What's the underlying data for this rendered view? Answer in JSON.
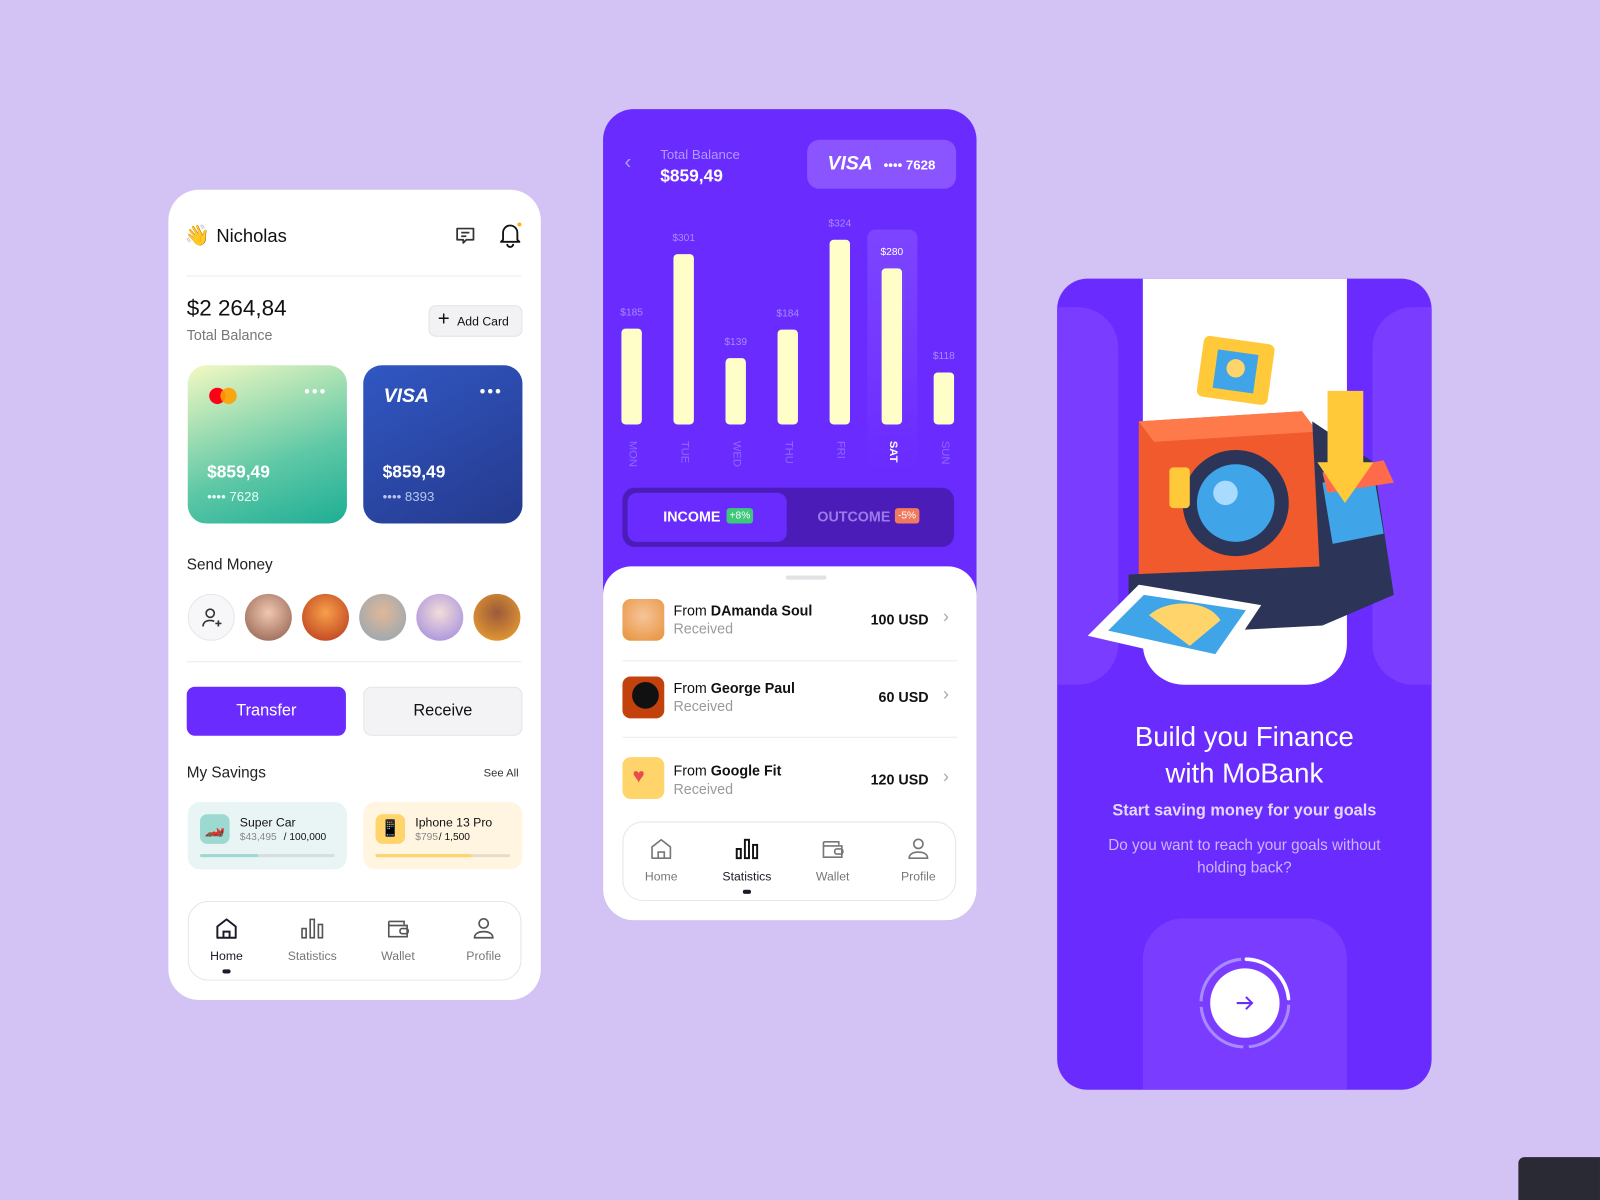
{
  "home": {
    "greeting_emoji": "👋",
    "user_name": "Nicholas",
    "icons": [
      "chat-icon",
      "bell-icon"
    ],
    "total_balance": "$2 264,84",
    "total_balance_label": "Total Balance",
    "add_card_label": "Add Card",
    "cards": [
      {
        "brand": "mastercard",
        "amount": "$859,49",
        "number": "•••• 7628",
        "colors": [
          "#f3f9c2",
          "#1dae95"
        ]
      },
      {
        "brand": "VISA",
        "amount": "$859,49",
        "number": "•••• 8393",
        "colors": [
          "#3157c3",
          "#253a8d"
        ]
      }
    ],
    "send_money_label": "Send Money",
    "contacts": [
      "#e8a48a",
      "#d45a2a",
      "#c9d4dc",
      "#b7a6e8",
      "#f0a030"
    ],
    "transfer_label": "Transfer",
    "receive_label": "Receive",
    "savings_label": "My Savings",
    "see_all_label": "See All",
    "savings": [
      {
        "name": "Super Car",
        "saved": "$43,495",
        "goal": "/ 100,000",
        "progress": 0.43,
        "emoji": "🏎️",
        "bg": "#e9f5f5",
        "icon_bg": "#9cd9d0",
        "fill": "#9cd9d0"
      },
      {
        "name": "Iphone 13 Pro",
        "saved": "$795",
        "goal": "/ 1,500",
        "progress": 0.71,
        "emoji": "📱",
        "bg": "#fff5e1",
        "icon_bg": "#ffd56b",
        "fill": "#ffd56b"
      }
    ],
    "nav": [
      "Home",
      "Statistics",
      "Wallet",
      "Profile"
    ],
    "active_nav": "Home"
  },
  "stats": {
    "total_balance_label": "Total Balance",
    "total_balance": "$859,49",
    "card_brand": "VISA",
    "card_number": "•••• 7628",
    "chart_data": {
      "type": "bar",
      "categories": [
        "MON",
        "TUE",
        "WED",
        "THU",
        "FRI",
        "SAT",
        "SUN"
      ],
      "values": [
        185,
        301,
        139,
        184,
        324,
        280,
        118
      ],
      "value_labels": [
        "$185",
        "$301",
        "$139",
        "$184",
        "$324",
        "$280",
        "$118"
      ],
      "highlighted": "SAT",
      "bar_color": "#fffdc8"
    },
    "income_label": "INCOME",
    "income_badge": "+8%",
    "outcome_label": "OUTCOME",
    "outcome_badge": "-5%",
    "transactions": [
      {
        "prefix": "From",
        "name": "DAmanda Soul",
        "status": "Received",
        "amount": "100 USD",
        "color": "#e6923a"
      },
      {
        "prefix": "From",
        "name": "George Paul",
        "status": "Received",
        "amount": "60 USD",
        "color": "#c2410c"
      },
      {
        "prefix": "From",
        "name": "Google Fit",
        "status": "Received",
        "amount": "120 USD",
        "color": "#ffd56b"
      }
    ],
    "nav": [
      "Home",
      "Statistics",
      "Wallet",
      "Profile"
    ],
    "active_nav": "Statistics"
  },
  "onboarding": {
    "title_line1": "Build you Finance",
    "title_line2": "with MoBank",
    "subtitle": "Start saving money for your goals",
    "body_line1": "Do you want to reach your goals without",
    "body_line2": "holding back?",
    "progress": 0.25,
    "next_icon": "arrow-right-icon"
  },
  "colors": {
    "accent": "#6a2bff",
    "background": "#d3c3f5"
  }
}
